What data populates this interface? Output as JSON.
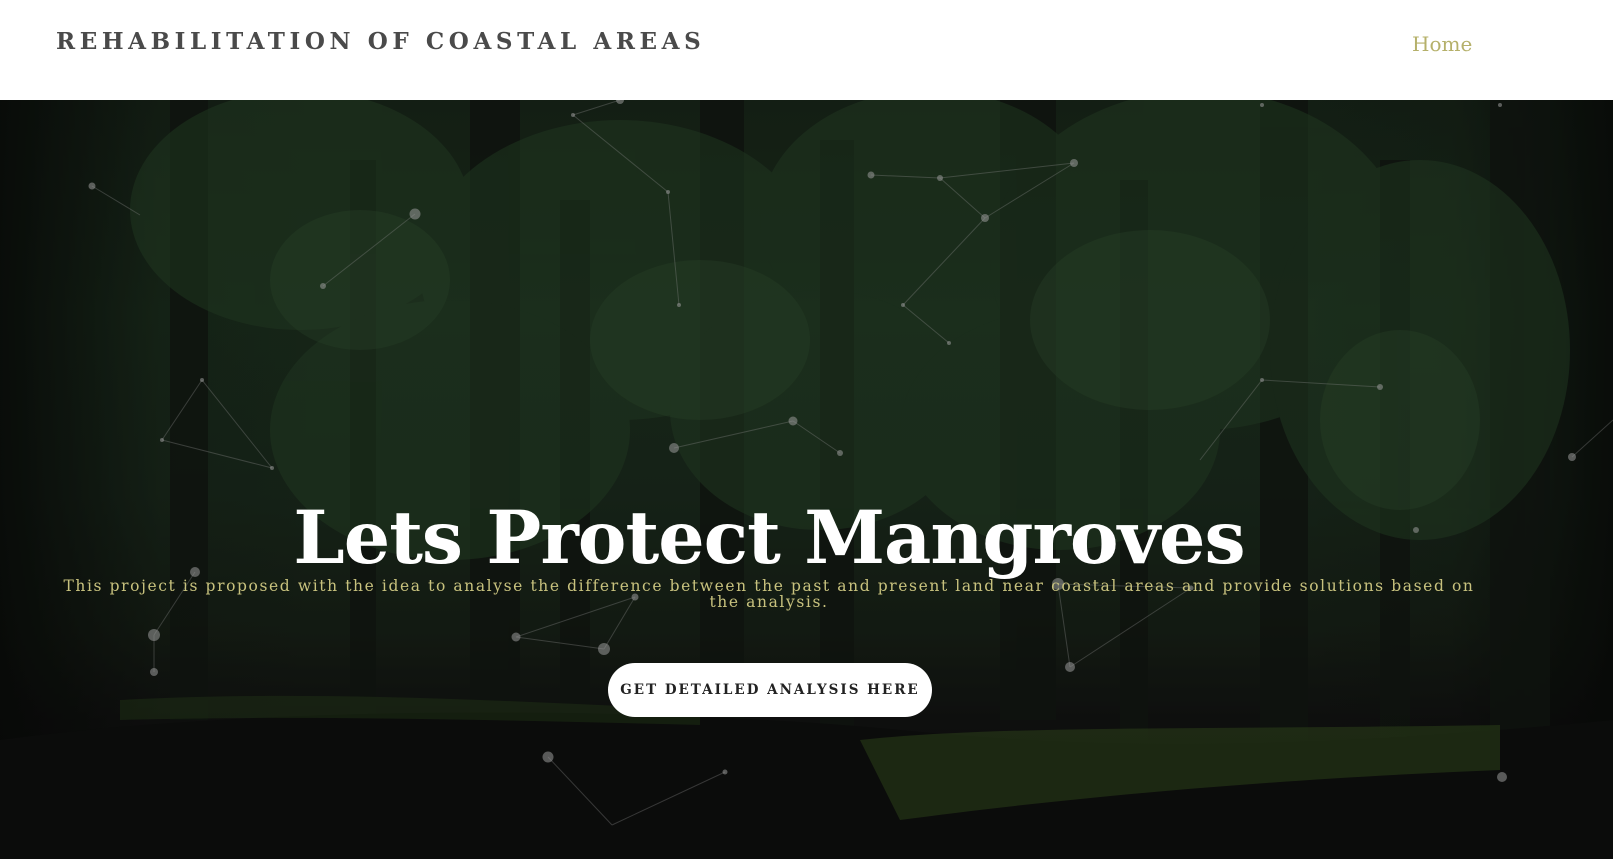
{
  "header": {
    "brand": "REHABILITATION OF COASTAL AREAS",
    "nav": [
      {
        "label": "Home"
      }
    ]
  },
  "hero": {
    "title": "Lets Protect Mangroves",
    "subtitle": "This project is proposed with the idea to analyse the difference between the past and present land near coastal areas and provide solutions based on the analysis.",
    "cta_label": "GET DETAILED ANALYSIS HERE",
    "background": "mangrove-forest-photo",
    "overlay": "particle-network"
  },
  "colors": {
    "brand_text": "#4a4a4a",
    "nav_link": "#b5b06a",
    "subtitle": "#c8c27e",
    "title": "#ffffff",
    "cta_bg": "#ffffff",
    "cta_text": "#222222"
  }
}
